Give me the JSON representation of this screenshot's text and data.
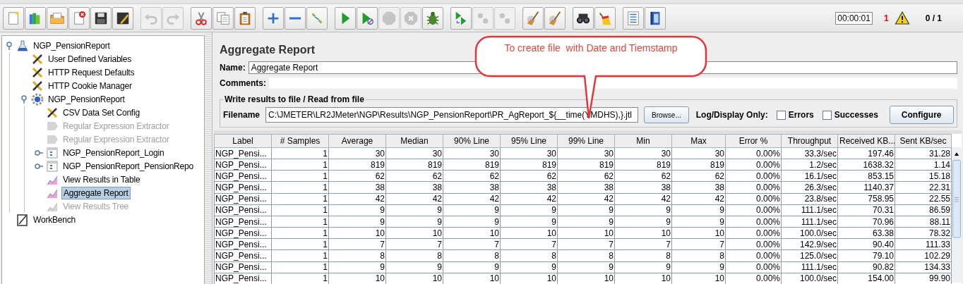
{
  "toolbar": {
    "groups": [
      [
        {
          "kind": "new",
          "disabled": false
        },
        {
          "kind": "templates",
          "disabled": false
        },
        {
          "kind": "open",
          "disabled": false
        },
        {
          "kind": "close",
          "disabled": false
        },
        {
          "kind": "save",
          "disabled": false
        },
        {
          "kind": "save-as",
          "disabled": false
        }
      ],
      [
        {
          "kind": "undo",
          "disabled": true
        },
        {
          "kind": "redo",
          "disabled": true
        }
      ],
      [
        {
          "kind": "cut",
          "disabled": false
        },
        {
          "kind": "copy",
          "disabled": false
        },
        {
          "kind": "paste",
          "disabled": false
        }
      ],
      [
        {
          "kind": "expand",
          "disabled": false
        },
        {
          "kind": "collapse",
          "disabled": false
        },
        {
          "kind": "toggle",
          "disabled": false
        }
      ],
      [
        {
          "kind": "start",
          "disabled": false
        },
        {
          "kind": "start-no-pause",
          "disabled": false
        },
        {
          "kind": "stop",
          "disabled": true
        },
        {
          "kind": "shutdown",
          "disabled": true
        },
        {
          "kind": "validate",
          "disabled": false
        }
      ],
      [
        {
          "kind": "remote-start",
          "disabled": false
        },
        {
          "kind": "remote-stop",
          "disabled": true
        },
        {
          "kind": "remote-exit",
          "disabled": true
        }
      ],
      [
        {
          "kind": "clear",
          "disabled": false
        },
        {
          "kind": "clear-all",
          "disabled": false
        }
      ],
      [
        {
          "kind": "search",
          "disabled": false
        },
        {
          "kind": "reset-search",
          "disabled": false
        }
      ],
      [
        {
          "kind": "functions",
          "disabled": false
        },
        {
          "kind": "help",
          "disabled": false
        }
      ]
    ]
  },
  "status": {
    "elapsed": "00:00:01",
    "warnings": "1",
    "threads": "0 / 1"
  },
  "tree": [
    {
      "label": "NGP_PensionReport",
      "kind": "testplan",
      "expanded": true,
      "disabled": false,
      "selected": false,
      "children": [
        {
          "label": "User Defined Variables",
          "kind": "config",
          "disabled": false,
          "selected": false
        },
        {
          "label": "HTTP Request Defaults",
          "kind": "config",
          "disabled": false,
          "selected": false
        },
        {
          "label": "HTTP Cookie Manager",
          "kind": "config",
          "disabled": false,
          "selected": false
        },
        {
          "label": "NGP_PensionReport",
          "kind": "threadgroup",
          "expanded": true,
          "disabled": false,
          "selected": false,
          "children": [
            {
              "label": "CSV Data Set Config",
              "kind": "config",
              "disabled": false,
              "selected": false
            },
            {
              "label": "Regular Expression Extractor",
              "kind": "extractor",
              "disabled": true,
              "selected": false
            },
            {
              "label": "Regular Expression Extractor",
              "kind": "extractor",
              "disabled": true,
              "selected": false
            },
            {
              "label": "NGP_PensionReport_Login",
              "kind": "controller",
              "expanded": false,
              "disabled": false,
              "selected": false
            },
            {
              "label": "NGP_PensionReport_PensionRepo",
              "kind": "controller",
              "expanded": false,
              "disabled": false,
              "selected": false
            },
            {
              "label": "View Results in Table",
              "kind": "listener",
              "disabled": false,
              "selected": false
            },
            {
              "label": "Aggregate Report",
              "kind": "listener",
              "disabled": false,
              "selected": true
            },
            {
              "label": "View Results Tree",
              "kind": "listener",
              "disabled": true,
              "selected": false
            }
          ]
        }
      ]
    },
    {
      "label": "WorkBench",
      "kind": "workbench",
      "disabled": false,
      "selected": false
    }
  ],
  "panel": {
    "title": "Aggregate Report",
    "name_label": "Name:",
    "name_value": "Aggregate Report",
    "comments_label": "Comments:",
    "file_section": {
      "legend": "Write results to file / Read from file",
      "filename_label": "Filename",
      "filename_value": "C:\\JMETER\\LR2JMeter\\NGP\\Results\\NGP_PensionReport\\PR_AgReport_${__time(YMDHS),}.jtl",
      "browse": "Browse...",
      "log_label": "Log/Display Only:",
      "options": [
        {
          "label": "Errors",
          "checked": false
        },
        {
          "label": "Successes",
          "checked": false
        }
      ],
      "configure": "Configure"
    }
  },
  "table": {
    "columns": [
      "Label",
      "# Samples",
      "Average",
      "Median",
      "90% Line",
      "95% Line",
      "99% Line",
      "Min",
      "Max",
      "Error %",
      "Throughput",
      "Received KB...",
      "Sent KB/sec"
    ],
    "rows": [
      [
        "NGP_Pensi...",
        "1",
        "30",
        "30",
        "30",
        "30",
        "30",
        "30",
        "30",
        "0.00%",
        "33.3/sec",
        "197.46",
        "31.28"
      ],
      [
        "NGP_Pensi...",
        "1",
        "819",
        "819",
        "819",
        "819",
        "819",
        "819",
        "819",
        "0.00%",
        "1.2/sec",
        "1638.32",
        "1.14"
      ],
      [
        "NGP_Pensi...",
        "1",
        "62",
        "62",
        "62",
        "62",
        "62",
        "62",
        "62",
        "0.00%",
        "16.1/sec",
        "853.15",
        "15.18"
      ],
      [
        "NGP_Pensi...",
        "1",
        "38",
        "38",
        "38",
        "38",
        "38",
        "38",
        "38",
        "0.00%",
        "26.3/sec",
        "1140.37",
        "22.31"
      ],
      [
        "NGP_Pensi...",
        "1",
        "42",
        "42",
        "42",
        "42",
        "42",
        "42",
        "42",
        "0.00%",
        "23.8/sec",
        "758.95",
        "22.55"
      ],
      [
        "NGP_Pensi...",
        "1",
        "9",
        "9",
        "9",
        "9",
        "9",
        "9",
        "9",
        "0.00%",
        "111.1/sec",
        "70.31",
        "86.59"
      ],
      [
        "NGP_Pensi...",
        "1",
        "9",
        "9",
        "9",
        "9",
        "9",
        "9",
        "9",
        "0.00%",
        "111.1/sec",
        "70.96",
        "88.11"
      ],
      [
        "NGP_Pensi...",
        "1",
        "10",
        "10",
        "10",
        "10",
        "10",
        "10",
        "10",
        "0.00%",
        "100.0/sec",
        "63.38",
        "78.32"
      ],
      [
        "NGP_Pensi...",
        "1",
        "7",
        "7",
        "7",
        "7",
        "7",
        "7",
        "7",
        "0.00%",
        "142.9/sec",
        "90.40",
        "111.33"
      ],
      [
        "NGP_Pensi...",
        "1",
        "8",
        "8",
        "8",
        "8",
        "8",
        "8",
        "8",
        "0.00%",
        "125.0/sec",
        "79.10",
        "102.29"
      ],
      [
        "NGP_Pensi...",
        "1",
        "9",
        "9",
        "9",
        "9",
        "9",
        "9",
        "9",
        "0.00%",
        "111.1/sec",
        "90.82",
        "134.33"
      ],
      [
        "NGP_Pensi...",
        "1",
        "10",
        "10",
        "10",
        "10",
        "10",
        "10",
        "10",
        "0.00%",
        "100.0/sec",
        "154.00",
        "99.90"
      ]
    ]
  },
  "callout": {
    "text": "To create file  with Date and Tiemstamp"
  }
}
